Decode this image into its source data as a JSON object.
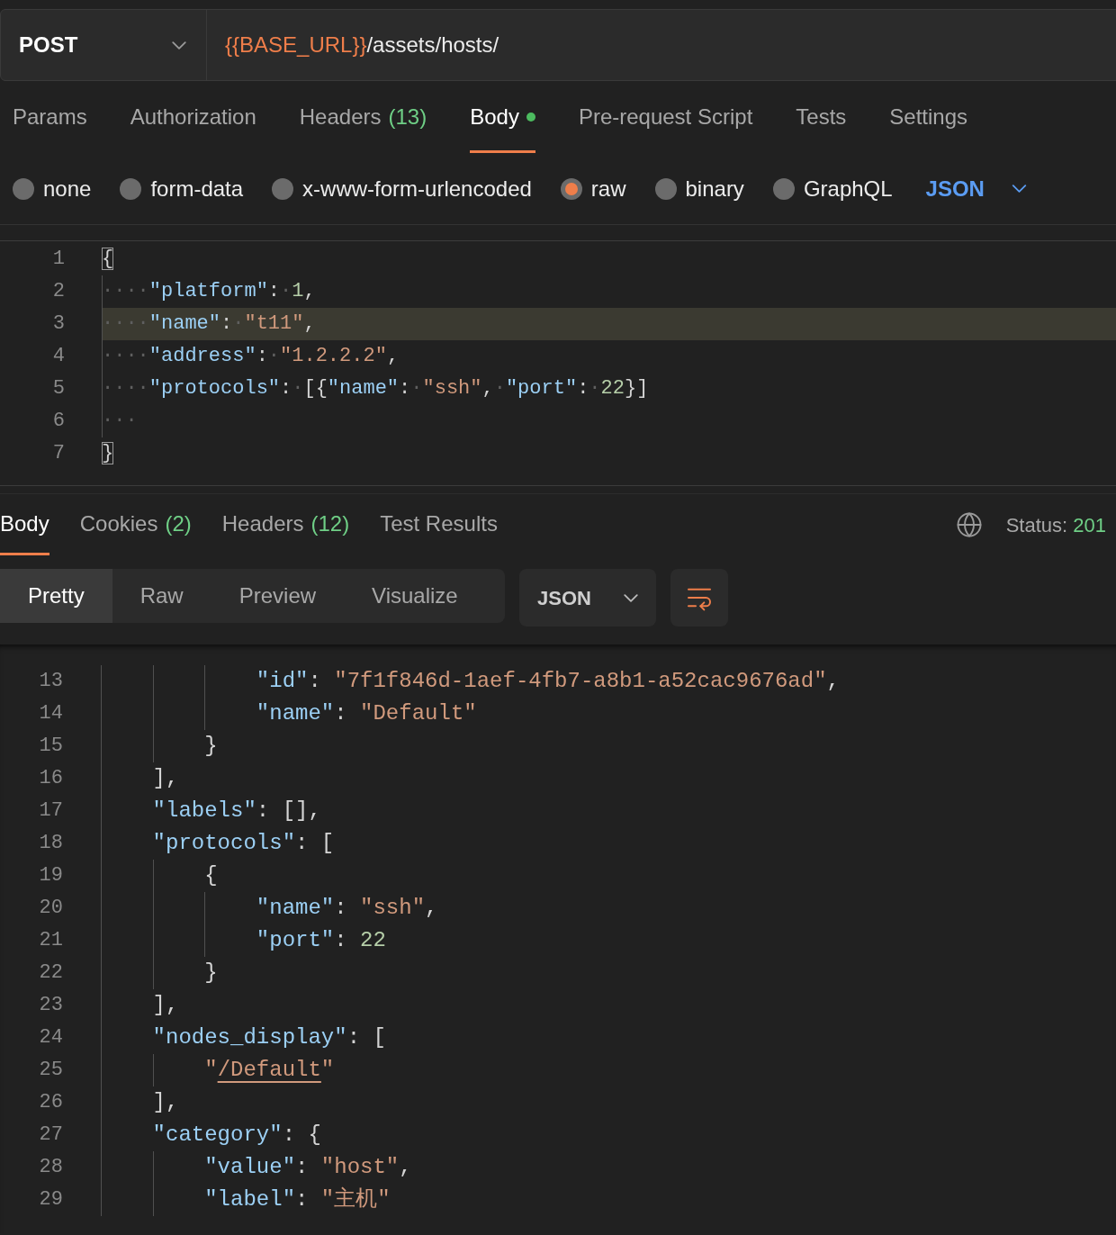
{
  "request": {
    "method": "POST",
    "url": [
      {
        "kind": "variable",
        "text": "{{BASE_URL}}"
      },
      {
        "kind": "path",
        "text": "/assets/hosts/"
      }
    ]
  },
  "request_tabs": [
    {
      "label": "Params",
      "selected": false,
      "modified": false
    },
    {
      "label": "Authorization",
      "selected": false,
      "modified": false
    },
    {
      "label": "Headers",
      "count": "(13)",
      "selected": false,
      "modified": false
    },
    {
      "label": "Body",
      "selected": true,
      "modified": true
    },
    {
      "label": "Pre-request Script",
      "selected": false,
      "modified": false
    },
    {
      "label": "Tests",
      "selected": false,
      "modified": false
    },
    {
      "label": "Settings",
      "selected": false,
      "modified": false
    }
  ],
  "body_types": [
    {
      "label": "none",
      "selected": false
    },
    {
      "label": "form-data",
      "selected": false
    },
    {
      "label": "x-www-form-urlencoded",
      "selected": false
    },
    {
      "label": "raw",
      "selected": true
    },
    {
      "label": "binary",
      "selected": false
    },
    {
      "label": "GraphQL",
      "selected": false
    }
  ],
  "body_format": "JSON",
  "request_editor": {
    "lines": [
      {
        "number": "1",
        "highlighted": false,
        "tokens": [
          {
            "kind": "match",
            "text": "{"
          }
        ]
      },
      {
        "number": "2",
        "highlighted": false,
        "tokens": [
          {
            "kind": "ws",
            "text": "····"
          },
          {
            "kind": "key",
            "text": "\"platform\""
          },
          {
            "kind": "punct",
            "text": ":"
          },
          {
            "kind": "ws",
            "text": "·"
          },
          {
            "kind": "num",
            "text": "1"
          },
          {
            "kind": "punct",
            "text": ","
          }
        ]
      },
      {
        "number": "3",
        "highlighted": true,
        "tokens": [
          {
            "kind": "ws",
            "text": "····"
          },
          {
            "kind": "key",
            "text": "\"name\""
          },
          {
            "kind": "punct",
            "text": ":"
          },
          {
            "kind": "ws",
            "text": "·"
          },
          {
            "kind": "str",
            "text": "\"t11\""
          },
          {
            "kind": "punct",
            "text": ","
          }
        ]
      },
      {
        "number": "4",
        "highlighted": false,
        "tokens": [
          {
            "kind": "ws",
            "text": "····"
          },
          {
            "kind": "key",
            "text": "\"address\""
          },
          {
            "kind": "punct",
            "text": ":"
          },
          {
            "kind": "ws",
            "text": "·"
          },
          {
            "kind": "str",
            "text": "\"1.2.2.2\""
          },
          {
            "kind": "punct",
            "text": ","
          }
        ]
      },
      {
        "number": "5",
        "highlighted": false,
        "tokens": [
          {
            "kind": "ws",
            "text": "····"
          },
          {
            "kind": "key",
            "text": "\"protocols\""
          },
          {
            "kind": "punct",
            "text": ":"
          },
          {
            "kind": "ws",
            "text": "·"
          },
          {
            "kind": "punct",
            "text": "[{"
          },
          {
            "kind": "key",
            "text": "\"name\""
          },
          {
            "kind": "punct",
            "text": ":"
          },
          {
            "kind": "ws",
            "text": "·"
          },
          {
            "kind": "str",
            "text": "\"ssh\""
          },
          {
            "kind": "punct",
            "text": ","
          },
          {
            "kind": "ws",
            "text": "·"
          },
          {
            "kind": "key",
            "text": "\"port\""
          },
          {
            "kind": "punct",
            "text": ":"
          },
          {
            "kind": "ws",
            "text": "·"
          },
          {
            "kind": "num",
            "text": "22"
          },
          {
            "kind": "punct",
            "text": "}]"
          }
        ]
      },
      {
        "number": "6",
        "highlighted": false,
        "tokens": [
          {
            "kind": "ws",
            "text": "···"
          }
        ]
      },
      {
        "number": "7",
        "highlighted": false,
        "tokens": [
          {
            "kind": "match",
            "text": "}"
          }
        ]
      }
    ]
  },
  "response_tabs": [
    {
      "label": "Body",
      "selected": true
    },
    {
      "label": "Cookies",
      "count": "(2)",
      "selected": false
    },
    {
      "label": "Headers",
      "count": "(12)",
      "selected": false
    },
    {
      "label": "Test Results",
      "selected": false
    }
  ],
  "status": {
    "label": "Status:",
    "code": "201"
  },
  "view_modes": [
    {
      "label": "Pretty",
      "selected": true
    },
    {
      "label": "Raw",
      "selected": false
    },
    {
      "label": "Preview",
      "selected": false
    },
    {
      "label": "Visualize",
      "selected": false
    }
  ],
  "response_format": "JSON",
  "response_editor": {
    "lines": [
      {
        "number": "13",
        "tokens": [
          {
            "kind": "key",
            "text": "            \"id\""
          },
          {
            "kind": "punct",
            "text": ": "
          },
          {
            "kind": "str",
            "text": "\"7f1f846d-1aef-4fb7-a8b1-a52cac9676ad\""
          },
          {
            "kind": "punct",
            "text": ","
          }
        ]
      },
      {
        "number": "14",
        "tokens": [
          {
            "kind": "key",
            "text": "            \"name\""
          },
          {
            "kind": "punct",
            "text": ": "
          },
          {
            "kind": "str",
            "text": "\"Default\""
          }
        ]
      },
      {
        "number": "15",
        "tokens": [
          {
            "kind": "punct",
            "text": "        }"
          }
        ]
      },
      {
        "number": "16",
        "tokens": [
          {
            "kind": "punct",
            "text": "    ],"
          }
        ]
      },
      {
        "number": "17",
        "tokens": [
          {
            "kind": "key",
            "text": "    \"labels\""
          },
          {
            "kind": "punct",
            "text": ": [],"
          }
        ]
      },
      {
        "number": "18",
        "tokens": [
          {
            "kind": "key",
            "text": "    \"protocols\""
          },
          {
            "kind": "punct",
            "text": ": ["
          }
        ]
      },
      {
        "number": "19",
        "tokens": [
          {
            "kind": "punct",
            "text": "        {"
          }
        ]
      },
      {
        "number": "20",
        "tokens": [
          {
            "kind": "key",
            "text": "            \"name\""
          },
          {
            "kind": "punct",
            "text": ": "
          },
          {
            "kind": "str",
            "text": "\"ssh\""
          },
          {
            "kind": "punct",
            "text": ","
          }
        ]
      },
      {
        "number": "21",
        "tokens": [
          {
            "kind": "key",
            "text": "            \"port\""
          },
          {
            "kind": "punct",
            "text": ": "
          },
          {
            "kind": "num",
            "text": "22"
          }
        ]
      },
      {
        "number": "22",
        "tokens": [
          {
            "kind": "punct",
            "text": "        }"
          }
        ]
      },
      {
        "number": "23",
        "tokens": [
          {
            "kind": "punct",
            "text": "    ],"
          }
        ]
      },
      {
        "number": "24",
        "tokens": [
          {
            "kind": "key",
            "text": "    \"nodes_display\""
          },
          {
            "kind": "punct",
            "text": ": ["
          }
        ]
      },
      {
        "number": "25",
        "tokens": [
          {
            "kind": "str",
            "text": "        \""
          },
          {
            "kind": "link",
            "text": "/Default"
          },
          {
            "kind": "str",
            "text": "\""
          }
        ]
      },
      {
        "number": "26",
        "tokens": [
          {
            "kind": "punct",
            "text": "    ],"
          }
        ]
      },
      {
        "number": "27",
        "tokens": [
          {
            "kind": "key",
            "text": "    \"category\""
          },
          {
            "kind": "punct",
            "text": ": {"
          }
        ]
      },
      {
        "number": "28",
        "tokens": [
          {
            "kind": "key",
            "text": "        \"value\""
          },
          {
            "kind": "punct",
            "text": ": "
          },
          {
            "kind": "str",
            "text": "\"host\""
          },
          {
            "kind": "punct",
            "text": ","
          }
        ]
      },
      {
        "number": "29",
        "tokens": [
          {
            "kind": "key",
            "text": "        \"label\""
          },
          {
            "kind": "punct",
            "text": ": "
          },
          {
            "kind": "str",
            "text": "\"主机\""
          }
        ]
      }
    ]
  }
}
